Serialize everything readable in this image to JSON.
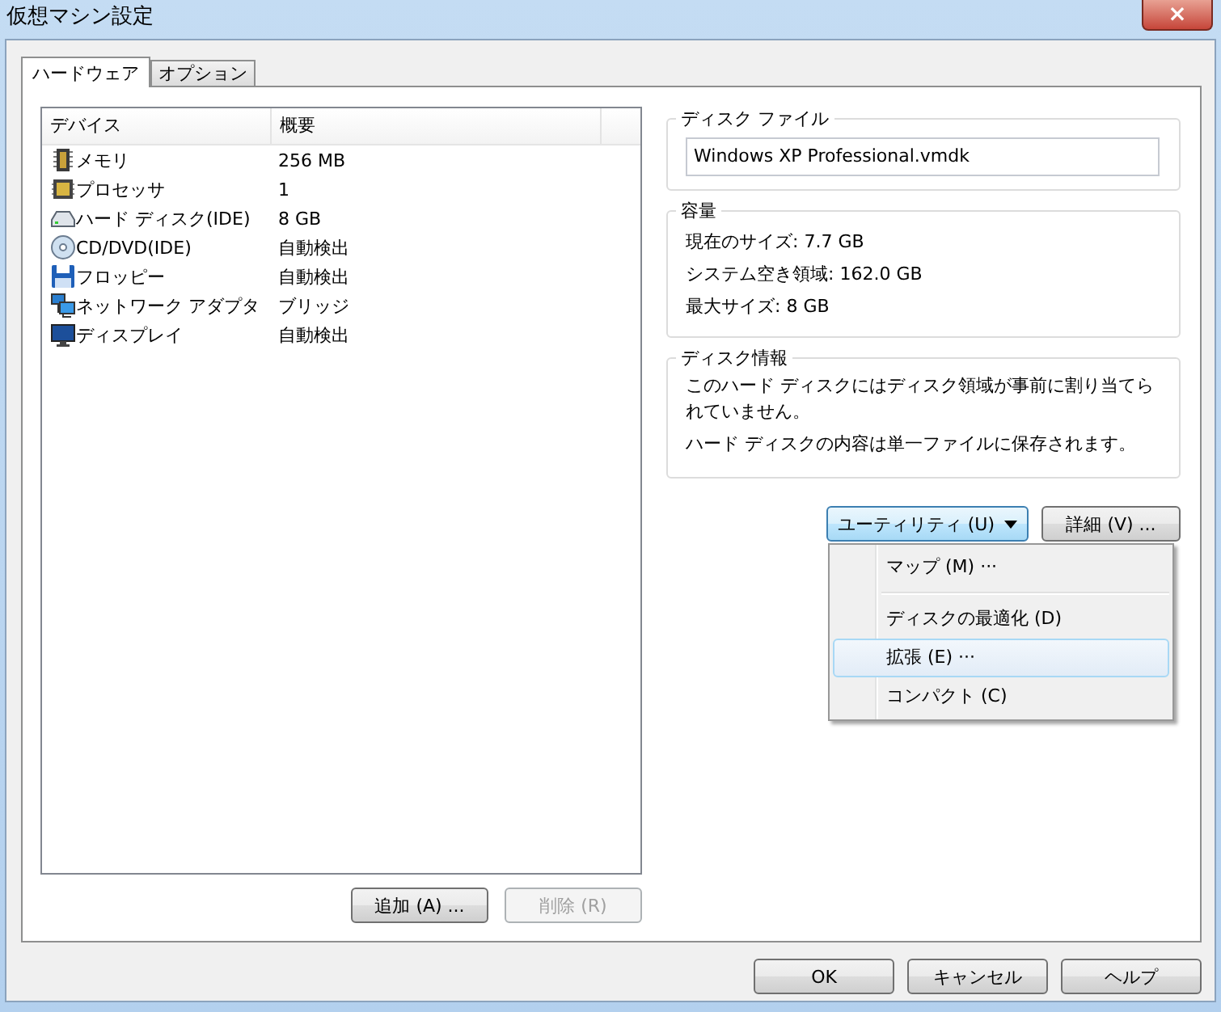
{
  "window": {
    "title": "仮想マシン設定",
    "close": "×"
  },
  "tabs": [
    {
      "label": "ハードウェア",
      "selected": true
    },
    {
      "label": "オプション",
      "selected": false
    }
  ],
  "device_list": {
    "columns": [
      "デバイス",
      "概要"
    ],
    "rows": [
      {
        "kind": "memory",
        "device": "メモリ",
        "summary": "256 MB"
      },
      {
        "kind": "processor",
        "device": "プロセッサ",
        "summary": "1"
      },
      {
        "kind": "harddisk",
        "device": "ハード ディスク(IDE)",
        "summary": "8 GB"
      },
      {
        "kind": "cdrom",
        "device": "CD/DVD(IDE)",
        "summary": "自動検出"
      },
      {
        "kind": "floppy",
        "device": "フロッピー",
        "summary": "自動検出"
      },
      {
        "kind": "network",
        "device": "ネットワーク アダプタ",
        "summary": "ブリッジ"
      },
      {
        "kind": "display",
        "device": "ディスプレイ",
        "summary": "自動検出"
      }
    ]
  },
  "list_buttons": [
    {
      "label": "追加 (A) ...",
      "disabled": false
    },
    {
      "label": "削除 (R)",
      "disabled": true
    }
  ],
  "disk_file": {
    "title": "ディスク ファイル",
    "value": "Windows XP Professional.vmdk"
  },
  "capacity": {
    "title": "容量",
    "lines": [
      "現在のサイズ: 7.7 GB",
      "システム空き領域: 162.0 GB",
      "最大サイズ: 8 GB"
    ]
  },
  "disk_info": {
    "title": "ディスク情報",
    "lines": [
      "このハード ディスクにはディスク領域が事前に割り当てられていません。",
      "ハード ディスクの内容は単一ファイルに保存されます。"
    ]
  },
  "utility_button": {
    "label": "ユーティリティ (U)",
    "expanded": true
  },
  "advanced_button": {
    "label": "詳細 (V) ..."
  },
  "utility_menu": [
    {
      "kind": "item",
      "label": "マップ (M) ···",
      "selected": false
    },
    {
      "kind": "separator"
    },
    {
      "kind": "item",
      "label": "ディスクの最適化 (D)",
      "selected": false
    },
    {
      "kind": "item",
      "label": "拡張 (E) ···",
      "selected": true
    },
    {
      "kind": "item",
      "label": "コンパクト (C)",
      "selected": false
    }
  ],
  "dialog_buttons": [
    "OK",
    "キャンセル",
    "ヘルプ"
  ]
}
